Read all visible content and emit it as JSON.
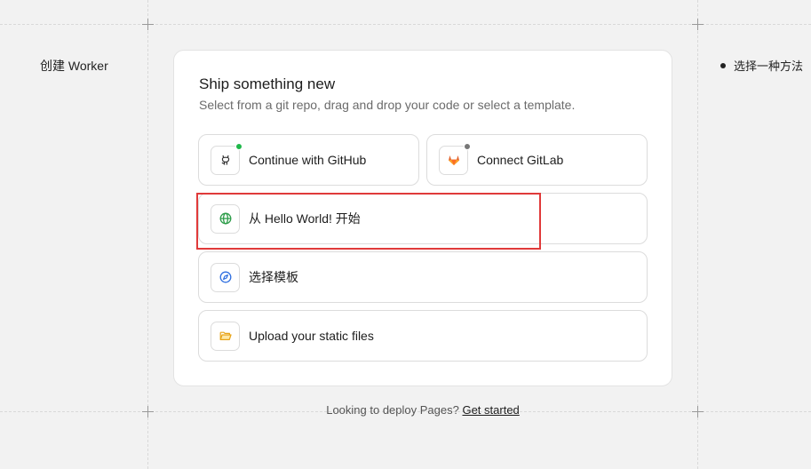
{
  "page": {
    "left_title": "创建 Worker",
    "step_label": "选择一种方法"
  },
  "card": {
    "title": "Ship something new",
    "subtitle": "Select from a git repo, drag and drop your code or select a template."
  },
  "options": {
    "github": {
      "label": "Continue with GitHub",
      "icon": "github-icon",
      "status_color": "#1fb84a"
    },
    "gitlab": {
      "label": "Connect GitLab",
      "icon": "gitlab-icon",
      "status_color": "#777777"
    },
    "hello_world": {
      "label": "从 Hello World! 开始",
      "icon": "globe-icon",
      "icon_color": "#2e9d4a"
    },
    "template": {
      "label": "选择模板",
      "icon": "compass-icon",
      "icon_color": "#2f6fe0"
    },
    "upload": {
      "label": "Upload your static files",
      "icon": "folder-icon",
      "icon_color": "#f0b429"
    }
  },
  "footer": {
    "text": "Looking to deploy Pages?",
    "link": "Get started"
  },
  "colors": {
    "highlight": "#e03a3a",
    "background": "#f2f2f2"
  }
}
